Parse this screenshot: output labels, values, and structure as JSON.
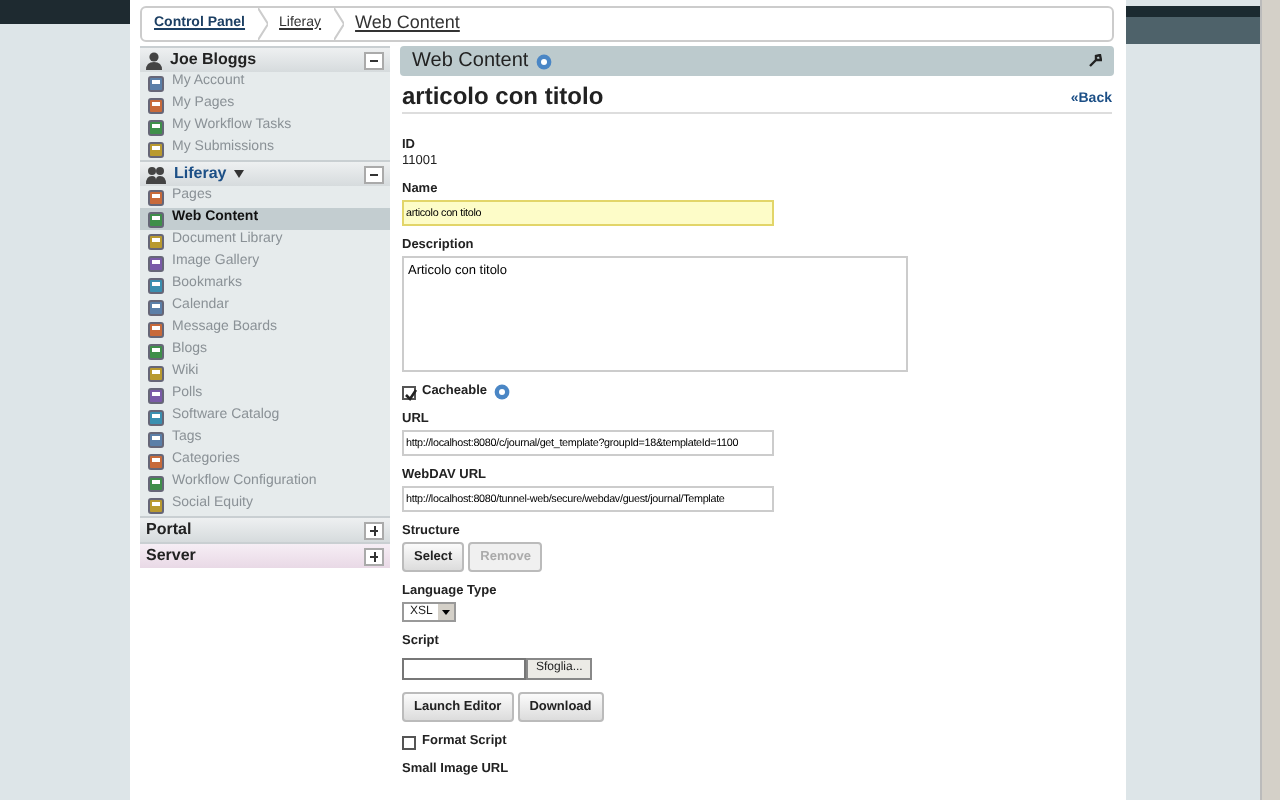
{
  "breadcrumb": [
    {
      "label": "Control Panel"
    },
    {
      "label": "Liferay"
    },
    {
      "label": "Web Content"
    }
  ],
  "sidebar": {
    "sections": [
      {
        "title": "Joe Bloggs",
        "kind": "user",
        "expanded": true,
        "hovered": false,
        "items": [
          {
            "label": "My Account",
            "selected": false
          },
          {
            "label": "My Pages",
            "selected": false
          },
          {
            "label": "My Workflow Tasks",
            "selected": false
          },
          {
            "label": "My Submissions",
            "selected": false
          }
        ]
      },
      {
        "title": "Liferay",
        "kind": "community",
        "expanded": true,
        "hovered": false,
        "items": [
          {
            "label": "Pages",
            "selected": false
          },
          {
            "label": "Web Content",
            "selected": true
          },
          {
            "label": "Document Library",
            "selected": false
          },
          {
            "label": "Image Gallery",
            "selected": false
          },
          {
            "label": "Bookmarks",
            "selected": false
          },
          {
            "label": "Calendar",
            "selected": false
          },
          {
            "label": "Message Boards",
            "selected": false
          },
          {
            "label": "Blogs",
            "selected": false
          },
          {
            "label": "Wiki",
            "selected": false
          },
          {
            "label": "Polls",
            "selected": false
          },
          {
            "label": "Software Catalog",
            "selected": false
          },
          {
            "label": "Tags",
            "selected": false
          },
          {
            "label": "Categories",
            "selected": false
          },
          {
            "label": "Workflow Configuration",
            "selected": false
          },
          {
            "label": "Social Equity",
            "selected": false
          }
        ]
      },
      {
        "title": "Portal",
        "kind": "plain",
        "expanded": false,
        "hovered": false
      },
      {
        "title": "Server",
        "kind": "plain",
        "expanded": false,
        "hovered": true
      }
    ]
  },
  "panel": {
    "title": "Web Content",
    "heading": "articolo con titolo",
    "back": "«Back",
    "fields": [
      {
        "kind": "static",
        "label": "ID",
        "value": "11001"
      },
      {
        "kind": "input",
        "label": "Name",
        "value": "articolo con titolo",
        "focused": true
      },
      {
        "kind": "textarea",
        "label": "Description",
        "value": "Articolo con titolo"
      },
      {
        "kind": "checkbox",
        "label": "Cacheable",
        "checked": true,
        "help": true
      },
      {
        "kind": "input",
        "label": "URL",
        "value": "http://localhost:8080/c/journal/get_template?groupId=18&templateId=1100",
        "focused": false
      },
      {
        "kind": "input",
        "label": "WebDAV URL",
        "value": "http://localhost:8080/tunnel-web/secure/webdav/guest/journal/Template",
        "focused": false
      },
      {
        "kind": "buttons",
        "label": "Structure",
        "buttons": [
          {
            "label": "Select",
            "disabled": false
          },
          {
            "label": "Remove",
            "disabled": true
          }
        ]
      },
      {
        "kind": "select",
        "label": "Language Type",
        "value": "XSL"
      },
      {
        "kind": "file",
        "label": "Script",
        "button": "Sfoglia..."
      },
      {
        "kind": "buttons",
        "buttons": [
          {
            "label": "Launch Editor",
            "disabled": false
          },
          {
            "label": "Download",
            "disabled": false
          }
        ]
      },
      {
        "kind": "checkbox",
        "label": "Format Script",
        "checked": false,
        "help": false
      },
      {
        "kind": "heading",
        "label": "Small Image URL"
      }
    ]
  }
}
